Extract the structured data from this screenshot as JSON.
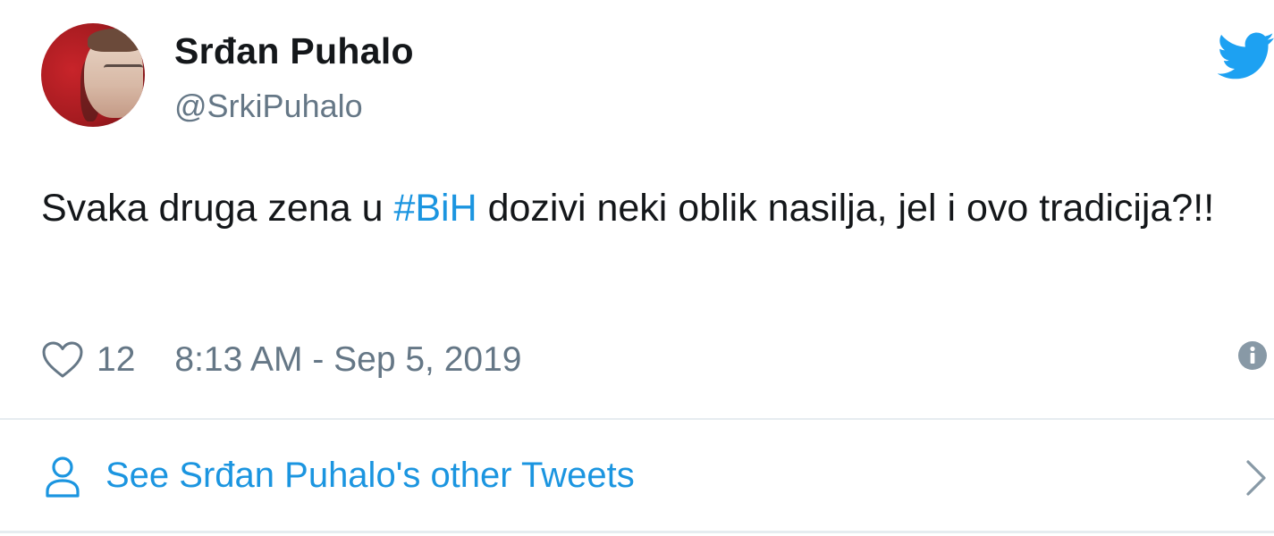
{
  "tweet": {
    "author_name": "Srđan Puhalo",
    "author_handle": "@SrkiPuhalo",
    "text_before": "Svaka druga zena u ",
    "hashtag": "#BiH",
    "text_after": " dozivi neki oblik nasilja, jel i ovo tradicija?!!",
    "like_count": "12",
    "timestamp": "8:13 AM - Sep 5, 2019"
  },
  "footer": {
    "other_tweets_label": "See Srđan Puhalo's other Tweets"
  },
  "icons": {
    "bird": "twitter-bird-icon",
    "heart": "heart-icon",
    "info": "info-icon",
    "person": "person-icon",
    "chevron": "chevron-right-icon"
  },
  "colors": {
    "link": "#1b95e0",
    "muted": "#657786",
    "text": "#14171a",
    "divider": "#e6ecf0",
    "twitter_blue": "#1da1f2"
  }
}
